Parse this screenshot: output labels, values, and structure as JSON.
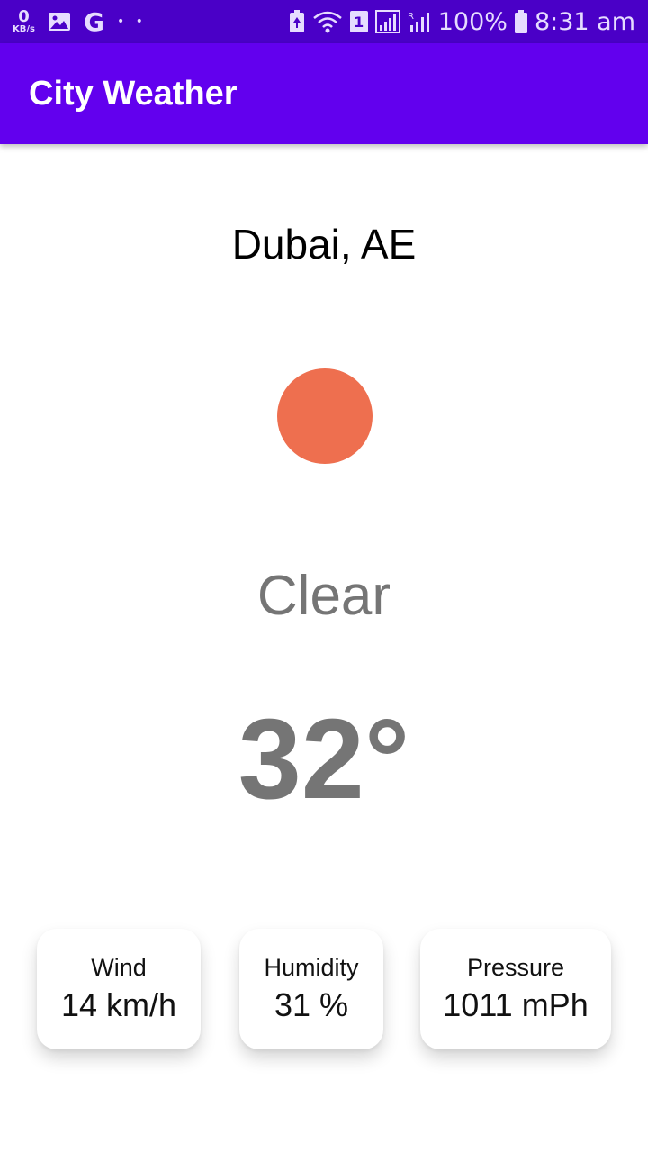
{
  "status_bar": {
    "net_speed_value": "0",
    "net_speed_unit": "KB/s",
    "google_letter": "G",
    "more_dots": "• •",
    "sim_number": "1",
    "battery_percent": "100%",
    "time": "8:31 am"
  },
  "app_bar": {
    "title": "City Weather"
  },
  "weather": {
    "city": "Dubai, AE",
    "condition": "Clear",
    "temperature": "32°",
    "icon_name": "sun-icon",
    "icon_color": "#ee6f4f"
  },
  "details": {
    "wind_label": "Wind",
    "wind_value": "14 km/h",
    "humidity_label": "Humidity",
    "humidity_value": "31 %",
    "pressure_label": "Pressure",
    "pressure_value": "1011 mPh"
  },
  "colors": {
    "status_bar": "#4a00c7",
    "app_bar": "#6200ee",
    "secondary_text": "#757575"
  }
}
